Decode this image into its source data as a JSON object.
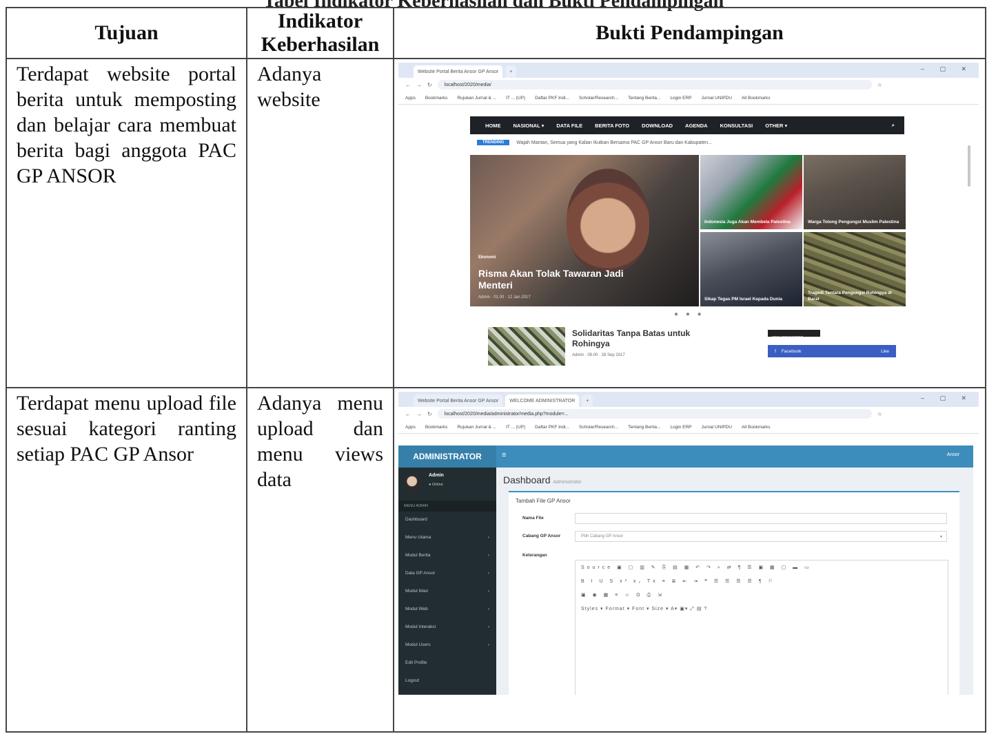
{
  "caption": "Tabel Indikator Keberhasilan dan Bukti Pendampingan",
  "table": {
    "headers": [
      "Tujuan",
      "Indikator Keberhasilan",
      "Bukti Pendampingan"
    ],
    "rows": [
      {
        "tujuan": "Terdapat website portal berita untuk memposting dan belajar cara membuat berita bagi anggota PAC GP ANSOR",
        "indikator": "Adanya website"
      },
      {
        "tujuan": "Terdapat menu upload file sesuai kategori ranting setiap PAC GP Ansor",
        "indikator": "Adanya menu upload dan menu views data"
      }
    ]
  },
  "screenshot1": {
    "tab": "Website Portal Berita Ansor GP Ansor",
    "url": "localhost/2020/media/",
    "bookmarks": [
      "Apps",
      "Bookmarks",
      "Rujukan Jurnal & ...",
      "IT ... (UP)",
      "Daftar PKF Indi...",
      "Scholar/Research...",
      "Tentang Berita...",
      "Login ERP",
      "Jurnal UNIPDU",
      "All Bookmarks"
    ],
    "nav": [
      "HOME",
      "NASIONAL ▾",
      "DATA FILE",
      "BERITA FOTO",
      "DOWNLOAD",
      "AGENDA",
      "KONSULTASI",
      "OTHER ▾"
    ],
    "ticker_badge": "TRENDING",
    "ticker_text": "Wajah Mantan, Semua yang Kalian Ikutkan Bersama PAC GP Ansor Baru dan Kabupaten...",
    "hero_category": "Ekonomi",
    "hero_headline": "Risma Akan Tolak Tawaran Jadi Menteri",
    "hero_meta": "Admin · 01.00 · 12 Jan 2017",
    "thumb1": "Indonesia Juga Akan Membela Palestina",
    "thumb2": "Warga Tolong Pengungsi Muslim Palestina",
    "thumb3": "Sikap Tegas PM Israel Kepada Dunia",
    "thumb4": "Tragedi Tentara Pengungsi Rohingya di Barat",
    "card_title": "Solidaritas Tanpa Batas untuk Rohingya",
    "card_meta": "Admin · 09.00 · 28 Sep 2017",
    "follow_label": "STAY CONNECTED",
    "fb_label": "Facebook",
    "fb_count": "Like"
  },
  "screenshot2": {
    "tabs": [
      "Website Portal Berita Ansor GP Ansor",
      "WELCOME ADMINISTRATOR"
    ],
    "url": "localhost/2020/media/administrator/media.php?module=...",
    "brand": "ADMINISTRATOR",
    "menu_icon": "≡",
    "user_top": "Ansor",
    "user_name": "Admin",
    "user_status": "● Online",
    "nav_header": "MENU ADMIN",
    "side_items": [
      "Dashboard",
      "Menu Utama",
      "Modul Berita",
      "Data GP Ansor",
      "Modul Iklan",
      "Modul Web",
      "Modul Interaksi",
      "Modul Users",
      "Edit Profile",
      "Logout"
    ],
    "dashboard": "Dashboard",
    "dashboard_sub": "Administrator",
    "box_title": "Tambah File GP Ansor",
    "label_nama": "Nama File",
    "label_cabang": "Cabang GP Ansor",
    "cabang_placeholder": "Pilih Cabang GP Ansor",
    "label_ket": "Keterangan",
    "tb1": "Source  ▣ ▢ ▥ ✎ ⎘ ▤ ▦ ↶ ↷ ⌕ ⇄ ¶ ☰ ▣ ▦ ▢ ▬ ▭",
    "tb2": "B I U S x² x₂ Tx ≡ ≣ ⇤ ⇥ ❝ ☰ ☰ ☰ ☰ ¶ ⚐",
    "tb3": "▣ ◉ ▦ ≡ ☺ Ω ⎙ ⇲",
    "tb4": "Styles ▾  Format ▾  Font ▾  Size ▾  A▾ ▣▾ ⤢ ▤ ?"
  }
}
